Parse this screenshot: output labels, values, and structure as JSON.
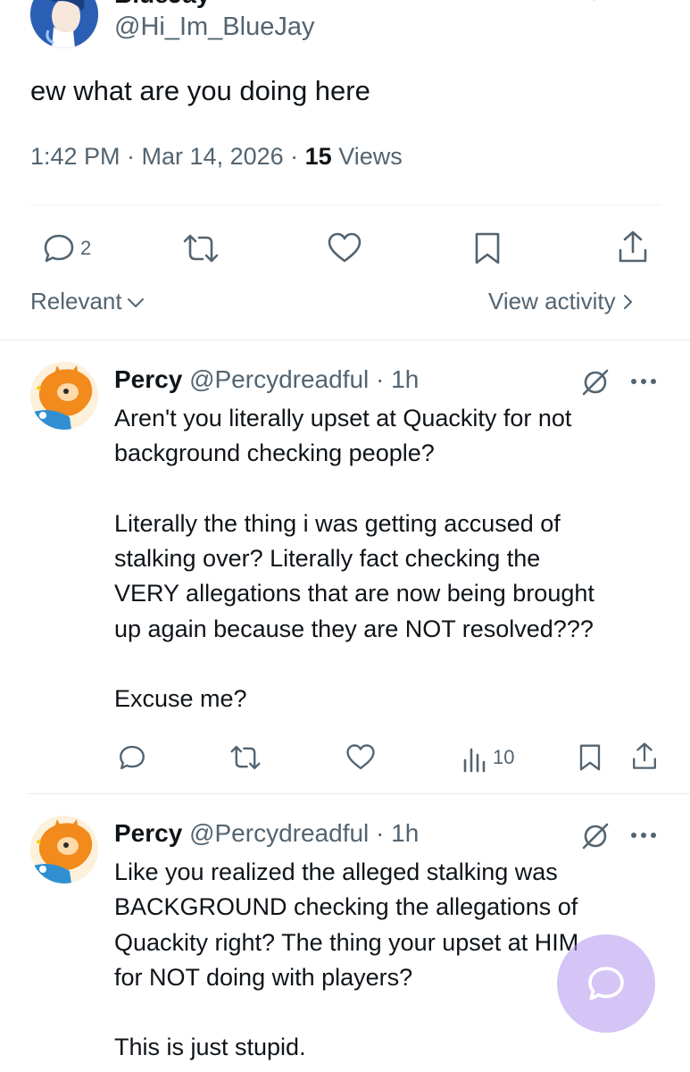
{
  "top_tweet": {
    "display_name": "BlueJay",
    "handle": "@Hi_Im_BlueJay",
    "text": "ew what are you doing here",
    "time": "1:42 PM · Mar 14, 2026 · ",
    "views_count": "15",
    "views_label": " Views",
    "reply_count": "2"
  },
  "sort": {
    "label": "Relevant"
  },
  "view_activity": {
    "label": "View activity"
  },
  "replies": [
    {
      "display_name": "Percy",
      "handle": "@Percydreadful",
      "time": " · 1h",
      "text": "Aren't you literally upset at Quackity for not\nbackground checking people?\n\nLiterally the thing i was getting accused of\nstalking over? Literally fact checking the\nVERY allegations that are now being brought\nup again because they are NOT resolved???\n\nExcuse me?",
      "views": "10"
    },
    {
      "display_name": "Percy",
      "handle": "@Percydreadful",
      "time": " · 1h",
      "text": "Like you realized the alleged stalking was\nBACKGROUND checking the allegations of\nQuackity right? The thing your upset at HIM\nfor NOT doing with players?\n\nThis is just stupid."
    }
  ],
  "colors": {
    "text": "#0f1419",
    "muted": "#536471",
    "fab": "#b296ee"
  }
}
